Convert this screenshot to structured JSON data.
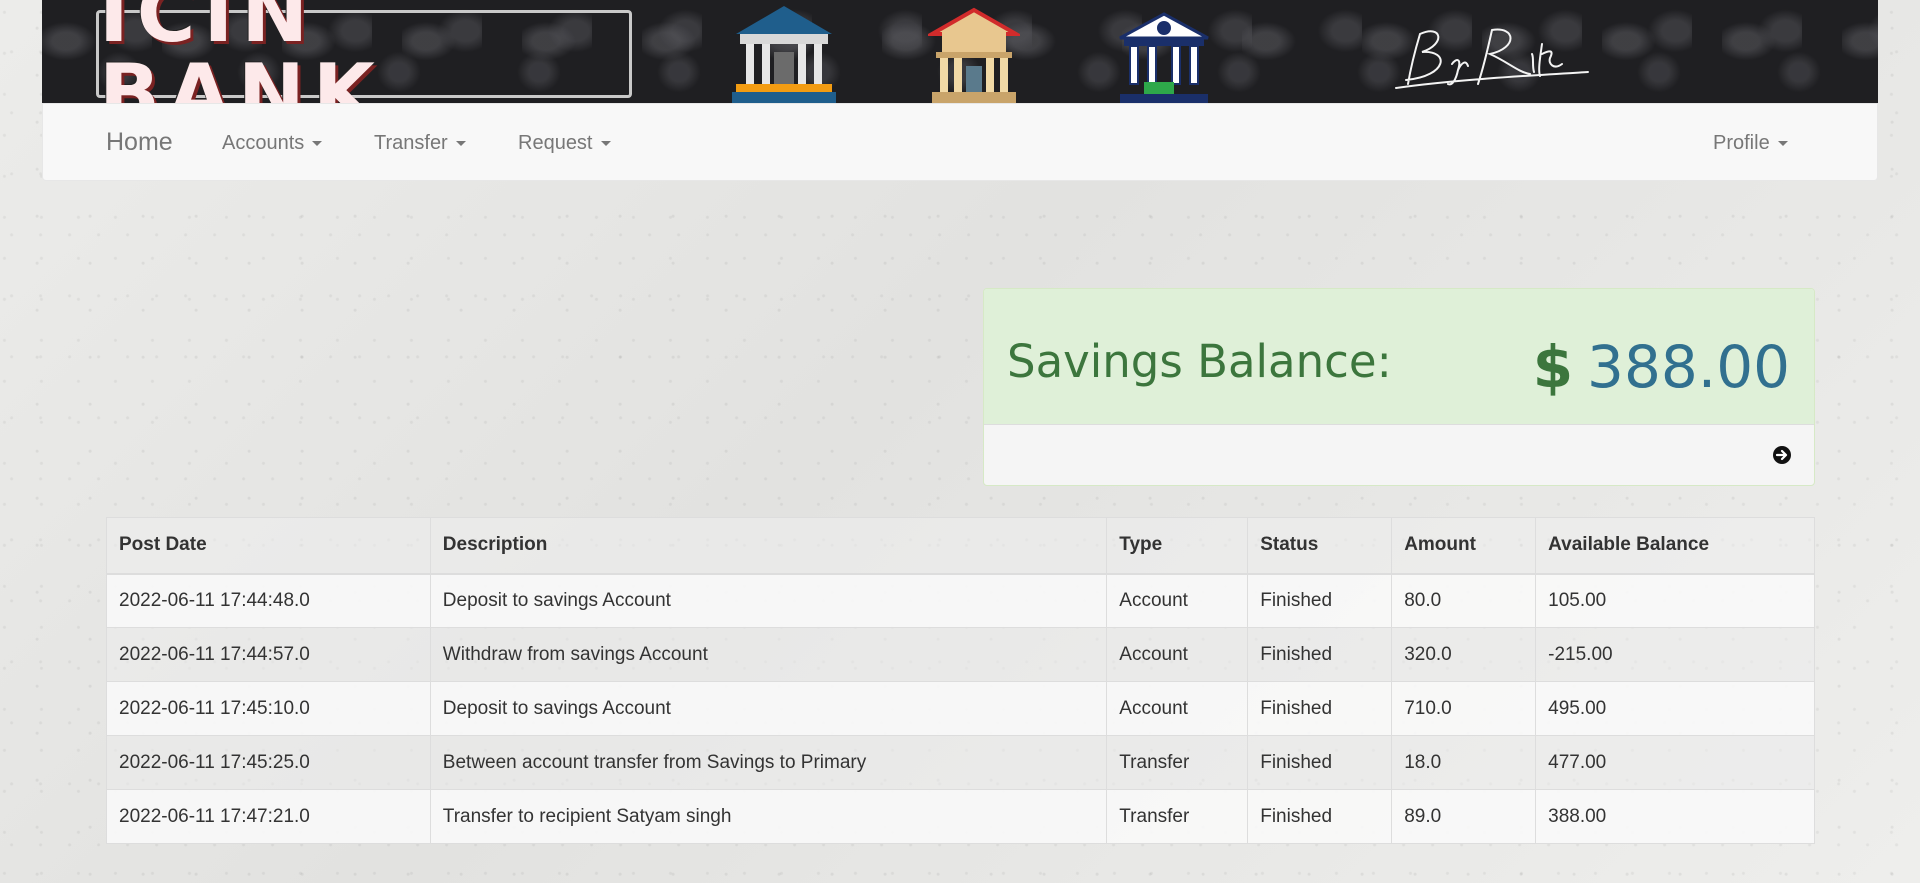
{
  "brand": {
    "title": "ICIN BANK",
    "signature": "By Ritik"
  },
  "nav": {
    "home": "Home",
    "accounts": "Accounts",
    "transfer": "Transfer",
    "request": "Request",
    "profile": "Profile"
  },
  "balance": {
    "label": "Savings Balance:",
    "currency_icon": "dollar-icon",
    "amount": "388.00",
    "footer_icon": "arrow-circle-right-icon",
    "colors": {
      "panel_bg": "#dff0d8",
      "label": "#3c763d",
      "amount": "#31708f"
    }
  },
  "table": {
    "headers": [
      "Post Date",
      "Description",
      "Type",
      "Status",
      "Amount",
      "Available Balance"
    ],
    "rows": [
      [
        "2022-06-11 17:44:48.0",
        "Deposit to savings Account",
        "Account",
        "Finished",
        "80.0",
        "105.00"
      ],
      [
        "2022-06-11 17:44:57.0",
        "Withdraw from savings Account",
        "Account",
        "Finished",
        "320.0",
        "-215.00"
      ],
      [
        "2022-06-11 17:45:10.0",
        "Deposit to savings Account",
        "Account",
        "Finished",
        "710.0",
        "495.00"
      ],
      [
        "2022-06-11 17:45:25.0",
        "Between account transfer from Savings to Primary",
        "Transfer",
        "Finished",
        "18.0",
        "477.00"
      ],
      [
        "2022-06-11 17:47:21.0",
        "Transfer to recipient Satyam singh",
        "Transfer",
        "Finished",
        "89.0",
        "388.00"
      ]
    ]
  }
}
